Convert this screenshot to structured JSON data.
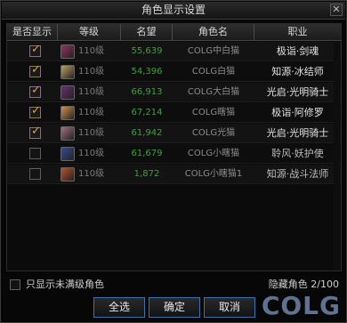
{
  "window": {
    "title": "角色显示设置"
  },
  "table": {
    "headers": [
      "是否显示",
      "等级",
      "名望",
      "角色名",
      "职业"
    ],
    "rows": [
      {
        "checked": true,
        "avatar_color": "#9a3060",
        "level": "110级",
        "fame": "55,639",
        "name": "COLG中白猫",
        "job": "极诣·剑魂"
      },
      {
        "checked": true,
        "avatar_color": "#c0a060",
        "level": "110级",
        "fame": "54,396",
        "name": "COLG白猫",
        "job": "知源·冰结师"
      },
      {
        "checked": true,
        "avatar_color": "#6a3070",
        "level": "110级",
        "fame": "66,913",
        "name": "COLG大白猫",
        "job": "光启·光明骑士"
      },
      {
        "checked": true,
        "avatar_color": "#d09050",
        "level": "110级",
        "fame": "67,214",
        "name": "COLG瞎猫",
        "job": "极诣·阿修罗"
      },
      {
        "checked": true,
        "avatar_color": "#a07080",
        "level": "110级",
        "fame": "61,942",
        "name": "COLG光猫",
        "job": "光启·光明骑士"
      },
      {
        "checked": false,
        "avatar_color": "#3a4a90",
        "level": "110级",
        "fame": "61,679",
        "name": "COLG小瞎猫",
        "job": "聆风·妖护使"
      },
      {
        "checked": false,
        "avatar_color": "#c05030",
        "level": "110级",
        "fame": "1,872",
        "name": "COLG小瞎猫1",
        "job": "知源·战斗法师"
      }
    ]
  },
  "footer": {
    "only_unfull_label": "只显示未满级角色",
    "hidden_count": "隐藏角色 2/100",
    "select_all": "全选",
    "confirm": "确定",
    "cancel": "取消"
  },
  "watermark": "COLG",
  "colors": {
    "check": "#e0a23a",
    "fame": "#3f9f3f",
    "button_border": "#3f6fa8"
  }
}
